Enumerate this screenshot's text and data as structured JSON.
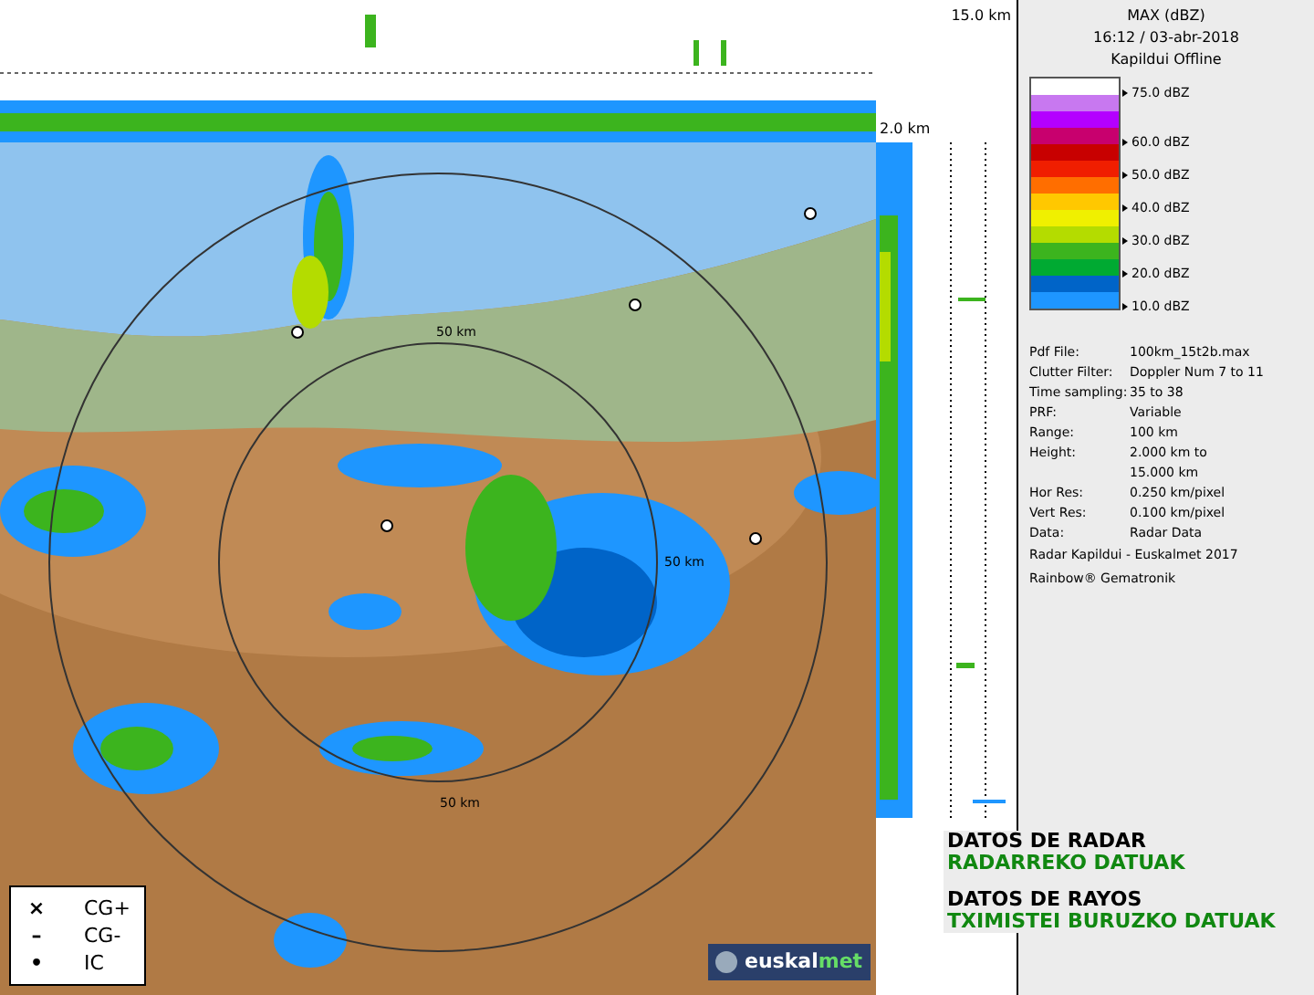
{
  "profile_labels": {
    "top_height": "15.0 km",
    "bottom_height": "2.0 km"
  },
  "map": {
    "ring_labels": [
      "50 km",
      "50 km",
      "50 km"
    ]
  },
  "legend": {
    "title": "MAX (dBZ)",
    "time": "16:12 / 03-abr-2018",
    "station": "Kapildui Offline",
    "bands": [
      {
        "color": "#ffffff",
        "label": "75.0 dBZ"
      },
      {
        "color": "#c878f0"
      },
      {
        "color": "#b400ff"
      },
      {
        "color": "#c8006e",
        "label": "60.0 dBZ"
      },
      {
        "color": "#c80000"
      },
      {
        "color": "#f01e00",
        "label": "50.0 dBZ"
      },
      {
        "color": "#ff6e00"
      },
      {
        "color": "#ffc800",
        "label": "40.0 dBZ"
      },
      {
        "color": "#f0f000"
      },
      {
        "color": "#b4dc00",
        "label": "30.0 dBZ"
      },
      {
        "color": "#3cb41e"
      },
      {
        "color": "#00aa32",
        "label": "20.0 dBZ"
      },
      {
        "color": "#0064c8"
      },
      {
        "color": "#1e96ff",
        "label": "10.0 dBZ"
      }
    ]
  },
  "info": [
    {
      "label": "Pdf File:",
      "value": "100km_15t2b.max"
    },
    {
      "label": "Clutter Filter:",
      "value": "Doppler Num 7 to 11"
    },
    {
      "label": "Time sampling:",
      "value": "35 to 38"
    },
    {
      "label": "PRF:",
      "value": "Variable"
    },
    {
      "label": "Range:",
      "value": "100 km"
    },
    {
      "label": "Height:",
      "value": "2.000 km to"
    },
    {
      "value": "15.000 km"
    },
    {
      "label": "Hor Res:",
      "value": "0.250 km/pixel"
    },
    {
      "label": "Vert Res:",
      "value": "0.100 km/pixel"
    },
    {
      "label": "Data:",
      "value": "Radar Data"
    }
  ],
  "credits": [
    "Radar Kapildui - Euskalmet 2017",
    "Rainbow® Gematronik"
  ],
  "links": [
    {
      "title": "DATOS DE RADAR",
      "subtitle": "RADARREKO DATUAK"
    },
    {
      "title": "DATOS DE RAYOS",
      "subtitle": "TXIMISTEI BURUZKO DATUAK"
    }
  ],
  "lightning_legend": [
    {
      "symbol": "×",
      "label": "CG+"
    },
    {
      "symbol": "–",
      "label": "CG-"
    },
    {
      "symbol": "•",
      "label": "IC"
    }
  ],
  "logo": {
    "text": "euskal",
    "accent": "met"
  }
}
